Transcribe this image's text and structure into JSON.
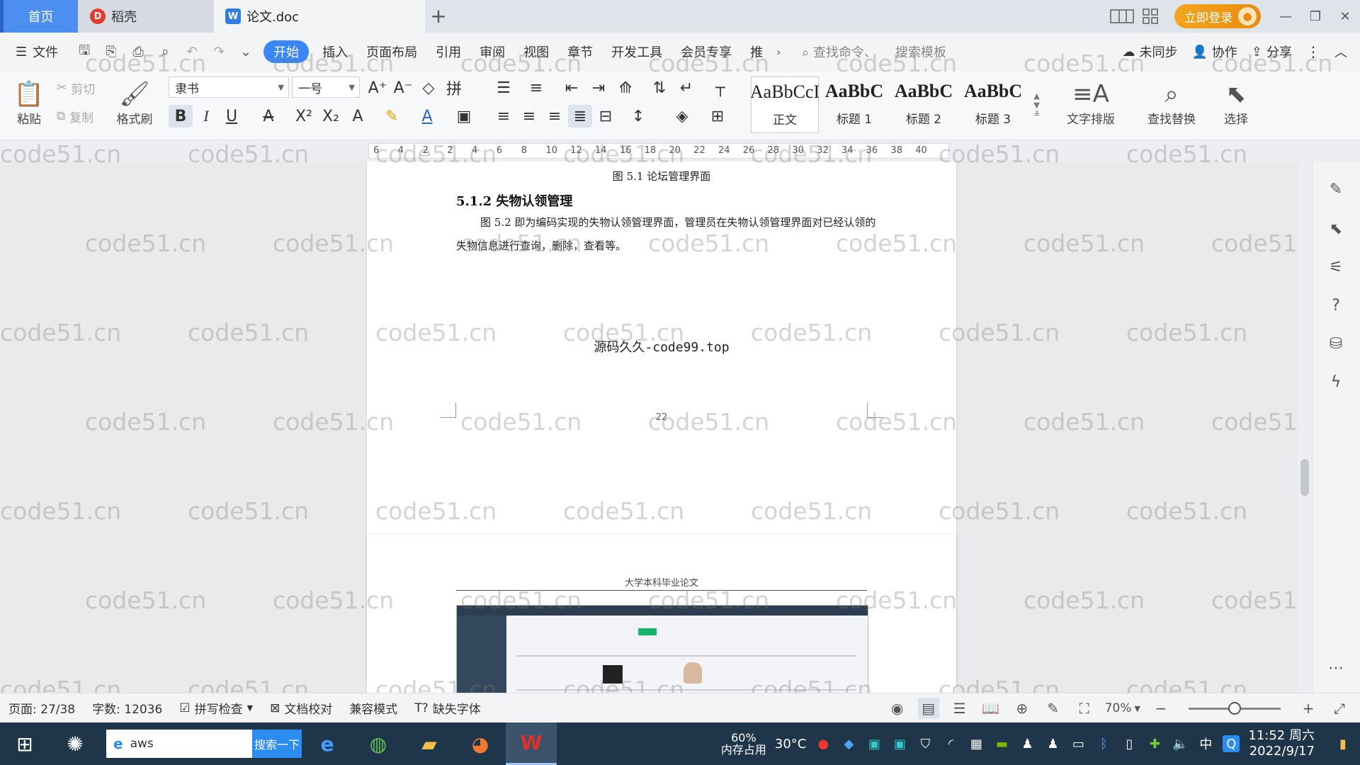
{
  "titlebar": {
    "tabs": [
      {
        "label": "首页"
      },
      {
        "label": "稻壳"
      },
      {
        "label": "论文.doc"
      }
    ],
    "login_label": "立即登录"
  },
  "menubar": {
    "file_label": "文件",
    "items": [
      "开始",
      "插入",
      "页面布局",
      "引用",
      "审阅",
      "视图",
      "章节",
      "开发工具",
      "会员专享",
      "推"
    ],
    "search_command": "查找命令、",
    "search_template": "搜索模板",
    "sync_label": "未同步",
    "collab_label": "协作",
    "share_label": "分享"
  },
  "ribbon": {
    "paste_label": "粘贴",
    "cut_label": "剪切",
    "copy_label": "复制",
    "format_painter_label": "格式刷",
    "font_name": "隶书",
    "font_size": "一号",
    "styles": [
      {
        "preview": "AaBbCcI",
        "label": "正文"
      },
      {
        "preview": "AaBbC",
        "label": "标题 1"
      },
      {
        "preview": "AaBbC",
        "label": "标题 2"
      },
      {
        "preview": "AaBbC",
        "label": "标题 3"
      }
    ],
    "text_layout_label": "文字排版",
    "find_replace_label": "查找替换",
    "select_label": "选择"
  },
  "ruler": {
    "numbers": [
      "6",
      "4",
      "2",
      "2",
      "4",
      "6",
      "8",
      "10",
      "12",
      "14",
      "16",
      "18",
      "20",
      "22",
      "24",
      "26",
      "28",
      "30",
      "32",
      "34",
      "36",
      "38",
      "40"
    ]
  },
  "document": {
    "figure_caption": "图 5.1  论坛管理界面",
    "section_heading": "5.1.2  失物认领管理",
    "paragraph": "图 5.2 即为编码实现的失物认领管理界面，管理员在失物认领管理界面对已经认领的失物信息进行查询，删除，查看等。",
    "source_text": "源码久久-code99.top",
    "page_number": "22",
    "next_page_header": "大学本科毕业论文"
  },
  "watermark": "code51.cn",
  "statusbar": {
    "page": "页面: 27/38",
    "word_count": "字数: 12036",
    "spell_check": "拼写检查",
    "doc_proof": "文档校对",
    "compat_mode": "兼容模式",
    "missing_font": "缺失字体",
    "zoom": "70%",
    "zoom_fraction": 0.5
  },
  "taskbar": {
    "search_value": "aws",
    "search_button": "搜索一下",
    "weather_percent": "60%",
    "weather_label": "内存占用",
    "temperature": "30°C",
    "ime": "中",
    "time": "11:52 周六",
    "date": "2022/9/17"
  }
}
